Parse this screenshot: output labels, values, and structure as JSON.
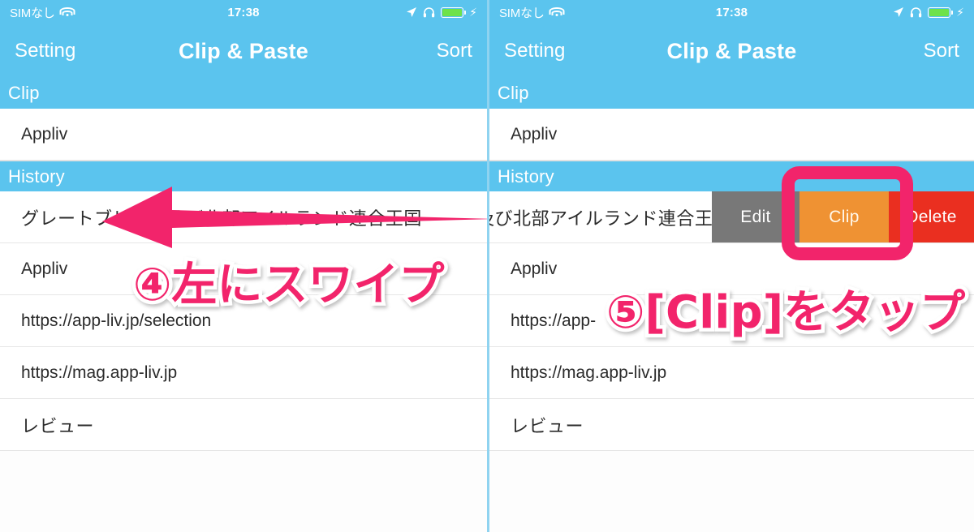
{
  "colors": {
    "brand_blue": "#5bc4ee",
    "annotation_pink": "#f2246b",
    "edit_gray": "#787878",
    "clip_orange": "#ef9233",
    "delete_red": "#ea2f20",
    "battery_green": "#6ee24a"
  },
  "statusbar": {
    "carrier": "SIMなし",
    "wifi_icon": "wifi-icon",
    "time": "17:38",
    "location_icon": "location-arrow-icon",
    "headphones_icon": "headphones-icon",
    "battery_icon": "battery-icon",
    "charging_icon": "lightning-bolt-icon"
  },
  "navbar": {
    "left_button": "Setting",
    "title": "Clip & Paste",
    "right_button": "Sort"
  },
  "sections": {
    "clip_header": "Clip",
    "history_header": "History"
  },
  "left_panel": {
    "clip_items": [
      "Appliv"
    ],
    "history_items": [
      "グレートブリテン及び北部アイルランド連合王国",
      "Appliv",
      "https://app-liv.jp/selection",
      "https://mag.app-liv.jp",
      "レビュー"
    ],
    "annotation": "④左にスワイプ",
    "arrow_icon": "left-arrow-icon"
  },
  "right_panel": {
    "clip_items": [
      "Appliv"
    ],
    "history_items": [
      "イルランド連合王国",
      "Appliv",
      "https://app-",
      "https://mag.app-liv.jp",
      "レビュー"
    ],
    "swipe_actions": [
      {
        "label": "Edit",
        "name": "edit"
      },
      {
        "label": "Clip",
        "name": "clip"
      },
      {
        "label": "Delete",
        "name": "delete"
      }
    ],
    "annotation": "⑤[Clip]をタップ",
    "highlight_target": "Clip"
  }
}
